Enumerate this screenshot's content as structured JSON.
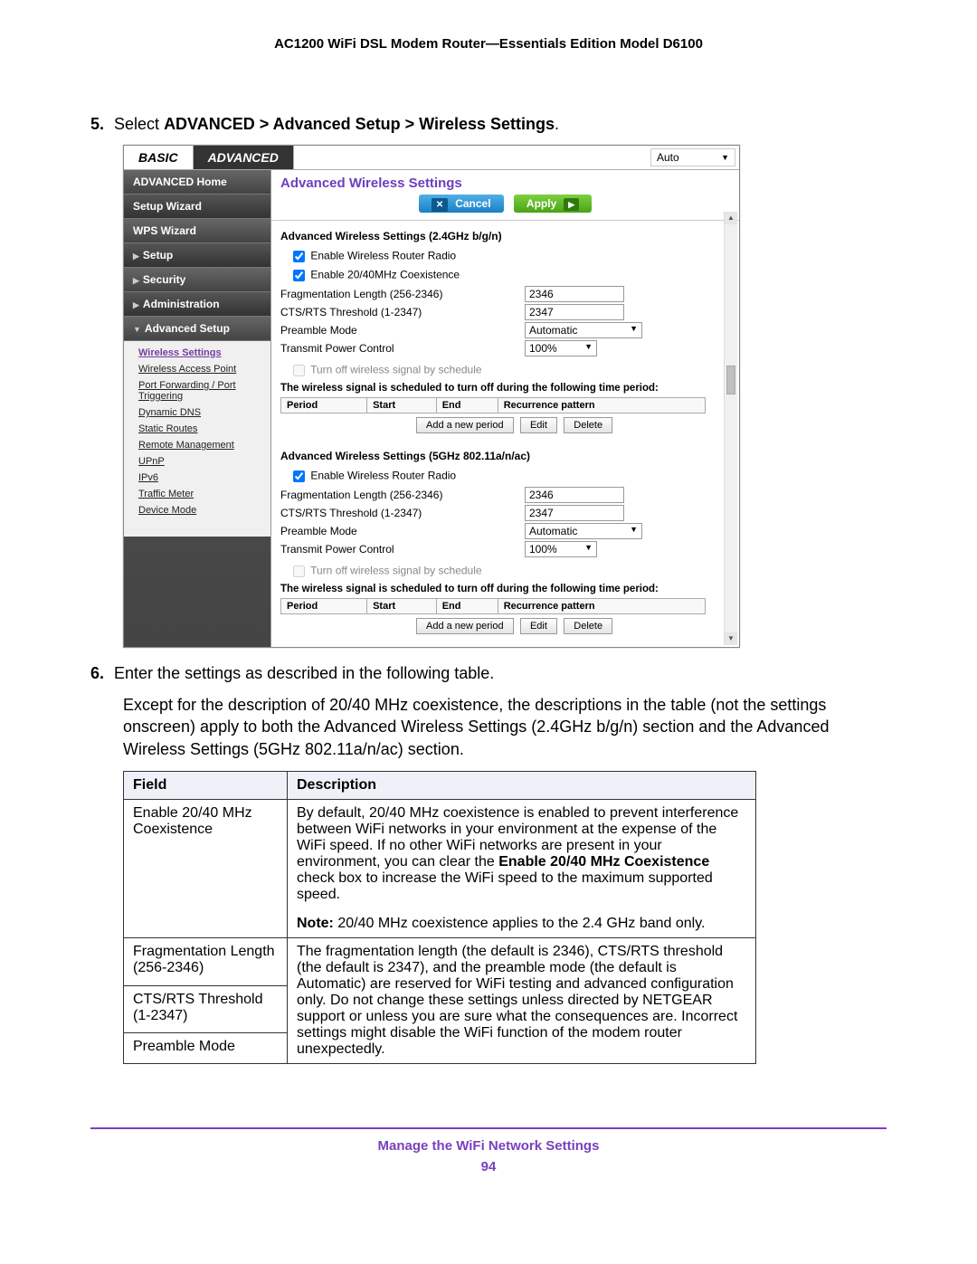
{
  "doc_header": "AC1200 WiFi DSL Modem Router—Essentials Edition Model D6100",
  "step5": {
    "num": "5.",
    "prefix": "Select ",
    "bold": "ADVANCED > Advanced Setup > Wireless Settings",
    "suffix": "."
  },
  "router": {
    "tabs": {
      "basic": "BASIC",
      "advanced": "ADVANCED"
    },
    "auto_label": "Auto",
    "sidebar": {
      "home": "ADVANCED Home",
      "setup_wizard": "Setup Wizard",
      "wps_wizard": "WPS Wizard",
      "setup": "Setup",
      "security": "Security",
      "administration": "Administration",
      "advanced_setup": "Advanced Setup",
      "sub": {
        "wireless_settings": "Wireless Settings",
        "wap": "Wireless Access Point",
        "port_fwd": "Port Forwarding / Port Triggering",
        "ddns": "Dynamic DNS",
        "static_routes": "Static Routes",
        "remote_mgmt": "Remote Management",
        "upnp": "UPnP",
        "ipv6": "IPv6",
        "traffic_meter": "Traffic Meter",
        "device_mode": "Device Mode"
      }
    },
    "title": "Advanced Wireless Settings",
    "buttons": {
      "cancel": "Cancel",
      "apply": "Apply"
    },
    "section24": {
      "heading": "Advanced Wireless Settings (2.4GHz b/g/n)",
      "enable_radio": "Enable Wireless Router Radio",
      "enable_coex": "Enable 20/40MHz Coexistence",
      "frag_label": "Fragmentation Length (256-2346)",
      "frag_value": "2346",
      "cts_label": "CTS/RTS Threshold (1-2347)",
      "cts_value": "2347",
      "preamble_label": "Preamble Mode",
      "preamble_value": "Automatic",
      "txpower_label": "Transmit Power Control",
      "txpower_value": "100%",
      "sched_chk": "Turn off wireless signal by schedule",
      "sched_note": "The wireless signal is scheduled to turn off during the following time period:",
      "th": {
        "period": "Period",
        "start": "Start",
        "end": "End",
        "recur": "Recurrence pattern"
      },
      "btns": {
        "add": "Add a new period",
        "edit": "Edit",
        "del": "Delete"
      }
    },
    "section5": {
      "heading": "Advanced Wireless Settings (5GHz 802.11a/n/ac)",
      "enable_radio": "Enable Wireless Router Radio",
      "frag_label": "Fragmentation Length (256-2346)",
      "frag_value": "2346",
      "cts_label": "CTS/RTS Threshold (1-2347)",
      "cts_value": "2347",
      "preamble_label": "Preamble Mode",
      "preamble_value": "Automatic",
      "txpower_label": "Transmit Power Control",
      "txpower_value": "100%",
      "sched_chk": "Turn off wireless signal by schedule",
      "sched_note": "The wireless signal is scheduled to turn off during the following time period:",
      "th": {
        "period": "Period",
        "start": "Start",
        "end": "End",
        "recur": "Recurrence pattern"
      },
      "btns": {
        "add": "Add a new period",
        "edit": "Edit",
        "del": "Delete"
      }
    }
  },
  "step6": {
    "num": "6.",
    "text": "Enter the settings as described in the following table."
  },
  "para_except": {
    "t1": "Except for the description of 20/40 MHz coexistence, the descriptions in the table (not the settings onscreen) apply to both the Advanced Wireless Settings (2.4GHz b/g/n) section and the Advanced Wireless Settings (5GHz 802.11a/n/ac) section."
  },
  "desc_table": {
    "hdr": {
      "field": "Field",
      "desc": "Description"
    },
    "row1": {
      "field": "Enable 20/40 MHz Coexistence",
      "desc1": "By default, 20/40 MHz coexistence is enabled to prevent interference between WiFi networks in your environment at the expense of the WiFi speed. If no other WiFi networks are present in your environment, you can clear the ",
      "bold1": "Enable 20/40 MHz Coexistence",
      "desc2": " check box to increase the WiFi speed to the maximum supported speed.",
      "note_prefix": "Note:",
      "note_text": "  20/40 MHz coexistence applies to the 2.4 GHz band only."
    },
    "row2a": {
      "field": "Fragmentation Length (256-2346)"
    },
    "row2b": {
      "field": "CTS/RTS Threshold (1-2347)"
    },
    "row2c": {
      "field": "Preamble Mode"
    },
    "row2desc": "The fragmentation length (the default is 2346), CTS/RTS threshold (the default is 2347), and the preamble mode (the default is Automatic) are reserved for WiFi testing and advanced configuration only. Do not change these settings unless directed by NETGEAR support or unless you are sure what the consequences are. Incorrect settings might disable the WiFi function of the modem router unexpectedly."
  },
  "footer": {
    "title": "Manage the WiFi Network Settings",
    "page": "94"
  }
}
